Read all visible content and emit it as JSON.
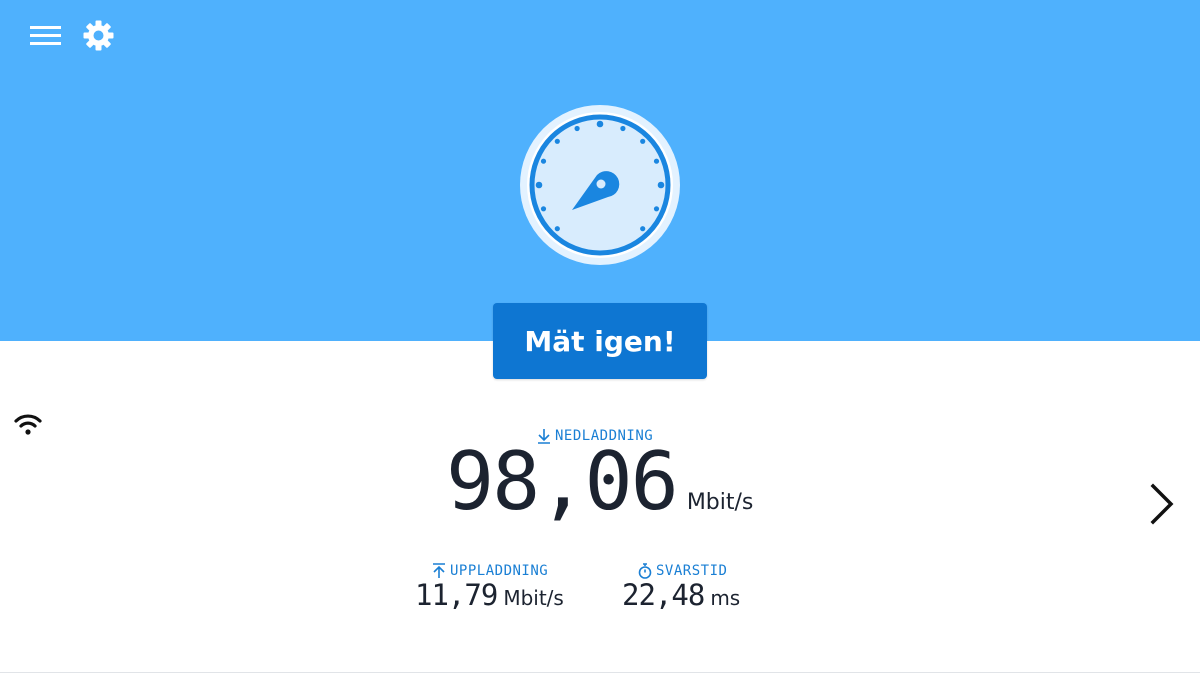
{
  "colors": {
    "hero_background": "#4fb1fd",
    "button_background": "#0e76d2",
    "accent_label": "#1a7fd4",
    "value_text": "#1c2330"
  },
  "header": {
    "menu_icon": "hamburger-menu-icon",
    "settings_icon": "gear-icon"
  },
  "gauge": {
    "icon": "speedometer-gauge-icon"
  },
  "actions": {
    "retest_label": "Mät igen!"
  },
  "connection": {
    "icon": "wifi-icon"
  },
  "results": {
    "download": {
      "label": "NEDLADDNING",
      "icon": "download-arrow-icon",
      "value": "98,06",
      "unit": "Mbit/s"
    },
    "upload": {
      "label": "UPPLADDNING",
      "icon": "upload-arrow-icon",
      "value": "11,79",
      "unit": "Mbit/s"
    },
    "latency": {
      "label": "SVARSTID",
      "icon": "stopwatch-icon",
      "value": "22,48",
      "unit": "ms"
    }
  },
  "navigation": {
    "next_icon": "chevron-right-icon"
  }
}
